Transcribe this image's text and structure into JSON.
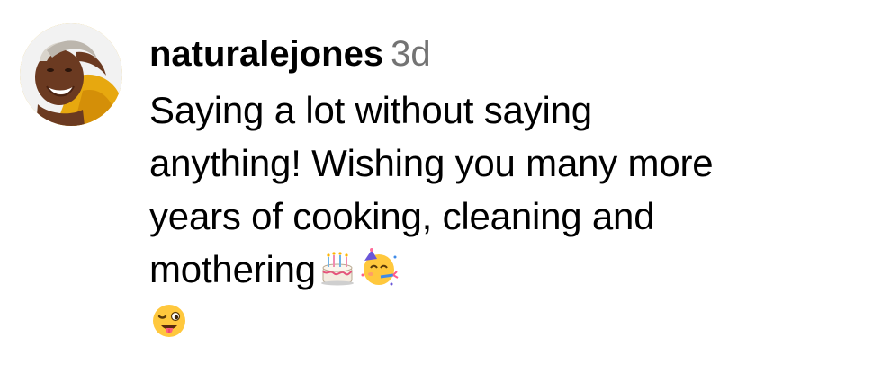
{
  "comment": {
    "username": "naturalejones",
    "timestamp": "3d",
    "text_lines": [
      "Saying a lot without saying",
      "anything! Wishing you many more",
      "years of cooking, cleaning and",
      "mothering"
    ],
    "inline_emojis": [
      "birthday-cake-emoji",
      "partying-face-emoji"
    ],
    "trailing_emoji": "winking-face-with-tongue-emoji"
  }
}
